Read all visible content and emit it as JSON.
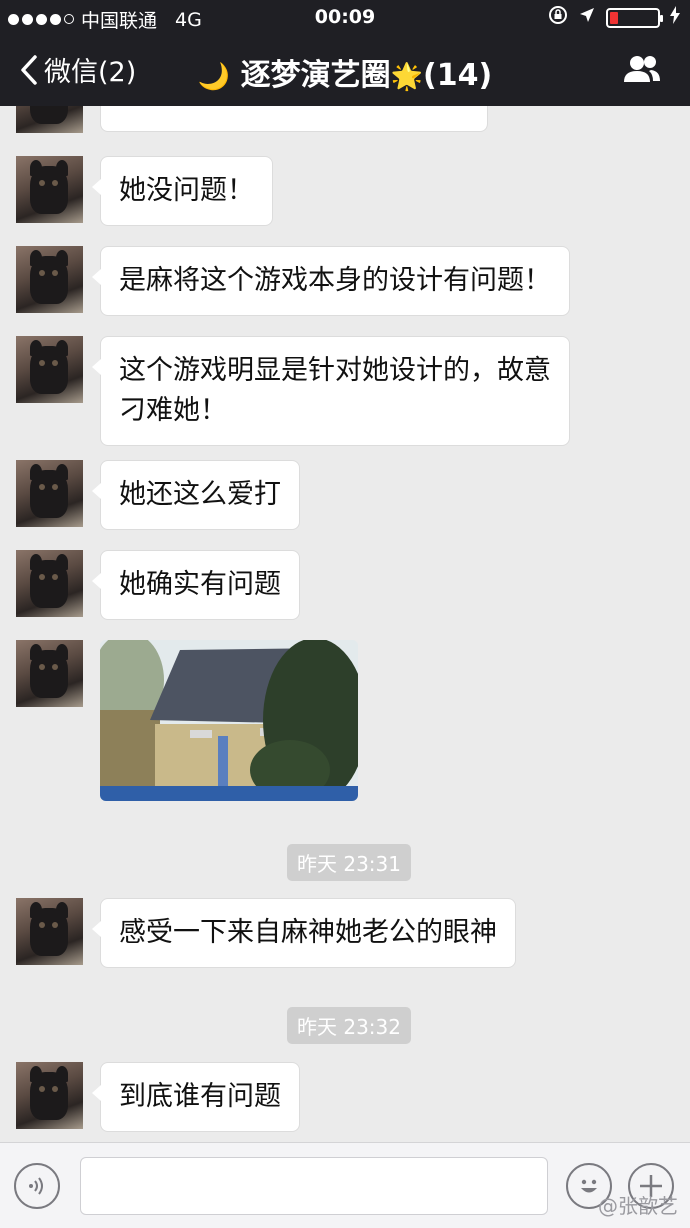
{
  "status_bar": {
    "carrier": "中国联通",
    "network": "4G",
    "time": "00:09"
  },
  "nav": {
    "back_label": "微信(2)",
    "title_moon": "🌙",
    "title_text": "逐梦演艺圈",
    "title_star": "🌟",
    "title_count": "(14)"
  },
  "messages": [
    {
      "type": "text",
      "text": "她没问题！"
    },
    {
      "type": "text",
      "text": "是麻将这个游戏本身的设计有问题！"
    },
    {
      "type": "text",
      "text": "这个游戏明显是针对她设计的，故意刁难她！"
    },
    {
      "type": "text",
      "text": "她还这么爱打"
    },
    {
      "type": "text",
      "text": "她确实有问题"
    },
    {
      "type": "image",
      "text": ""
    },
    {
      "type": "time",
      "text": "昨天 23:31"
    },
    {
      "type": "text",
      "text": "感受一下来自麻神她老公的眼神"
    },
    {
      "type": "time",
      "text": "昨天 23:32"
    },
    {
      "type": "text",
      "text": "到底谁有问题"
    }
  ],
  "input": {
    "value": "",
    "placeholder": ""
  },
  "watermark": "@张歆艺",
  "colors": {
    "header_bg": "#1f1f24",
    "chat_bg": "#ebebeb",
    "bubble_bg": "#ffffff",
    "timestamp_bg": "#cfcfcf",
    "battery_low": "#ee3333"
  },
  "icons": [
    "back-chevron-icon",
    "group-members-icon",
    "voice-icon",
    "emoji-icon",
    "plus-icon",
    "location-arrow-icon",
    "lock-rotation-icon",
    "charging-icon"
  ]
}
